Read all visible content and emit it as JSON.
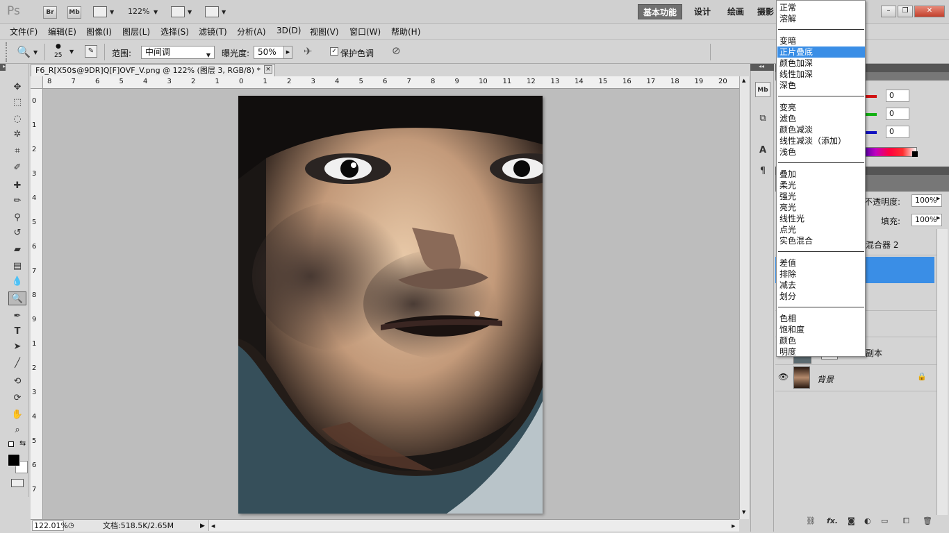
{
  "appbar": {
    "logo": "Ps",
    "bridge_label": "Br",
    "minibridge_label": "Mb",
    "zoom_value": "122%",
    "workspaces": [
      "基本功能",
      "设计",
      "绘画",
      "摄影"
    ]
  },
  "menubar": {
    "items": [
      "文件(F)",
      "编辑(E)",
      "图像(I)",
      "图层(L)",
      "选择(S)",
      "滤镜(T)",
      "分析(A)",
      "3D(D)",
      "视图(V)",
      "窗口(W)",
      "帮助(H)"
    ]
  },
  "options": {
    "brush_size": "25",
    "range_label": "范围:",
    "range_value": "中间调",
    "exposure_label": "曝光度:",
    "exposure_value": "50%",
    "protect_label": "保护色调",
    "protect_checked": true
  },
  "document": {
    "tab_title": "F6_R[X50$@9DR]Q[F]OVF_V.png @ 122% (图层 3, RGB/8) *",
    "ruler_h": [
      "8",
      "7",
      "6",
      "5",
      "4",
      "3",
      "2",
      "1",
      "0",
      "1",
      "2",
      "3",
      "4",
      "5",
      "6",
      "7",
      "8",
      "9",
      "10",
      "11",
      "12",
      "13",
      "14",
      "15",
      "16",
      "17",
      "18",
      "19",
      "20"
    ],
    "ruler_v": [
      "0",
      "1",
      "2",
      "3",
      "4",
      "5",
      "6",
      "7",
      "8",
      "9",
      "1",
      "2",
      "3",
      "4",
      "5",
      "6",
      "7"
    ],
    "zoom_status": "122.01%",
    "doc_status": "文档:518.5K/2.65M"
  },
  "color_panel": {
    "r": "0",
    "g": "0",
    "b": "0",
    "colors": {
      "r": "#d01010",
      "g": "#10b010",
      "b": "#1010c0"
    }
  },
  "layers_panel": {
    "opacity_label": "不透明度:",
    "opacity_value": "100%",
    "fill_label": "填充:",
    "fill_value": "100%",
    "mixer_partial": "混合器 2",
    "copy_partial": "副本",
    "background_name": "背景"
  },
  "blend_menu": {
    "groups": [
      [
        "正常",
        "溶解"
      ],
      [
        "变暗",
        "正片叠底",
        "颜色加深",
        "线性加深",
        "深色"
      ],
      [
        "变亮",
        "滤色",
        "颜色减淡",
        "线性减淡（添加）",
        "浅色"
      ],
      [
        "叠加",
        "柔光",
        "强光",
        "亮光",
        "线性光",
        "点光",
        "实色混合"
      ],
      [
        "差值",
        "排除",
        "减去",
        "划分"
      ],
      [
        "色相",
        "饱和度",
        "颜色",
        "明度"
      ]
    ],
    "selected": "正片叠底",
    "highlight_color": "#3a8ee6"
  }
}
